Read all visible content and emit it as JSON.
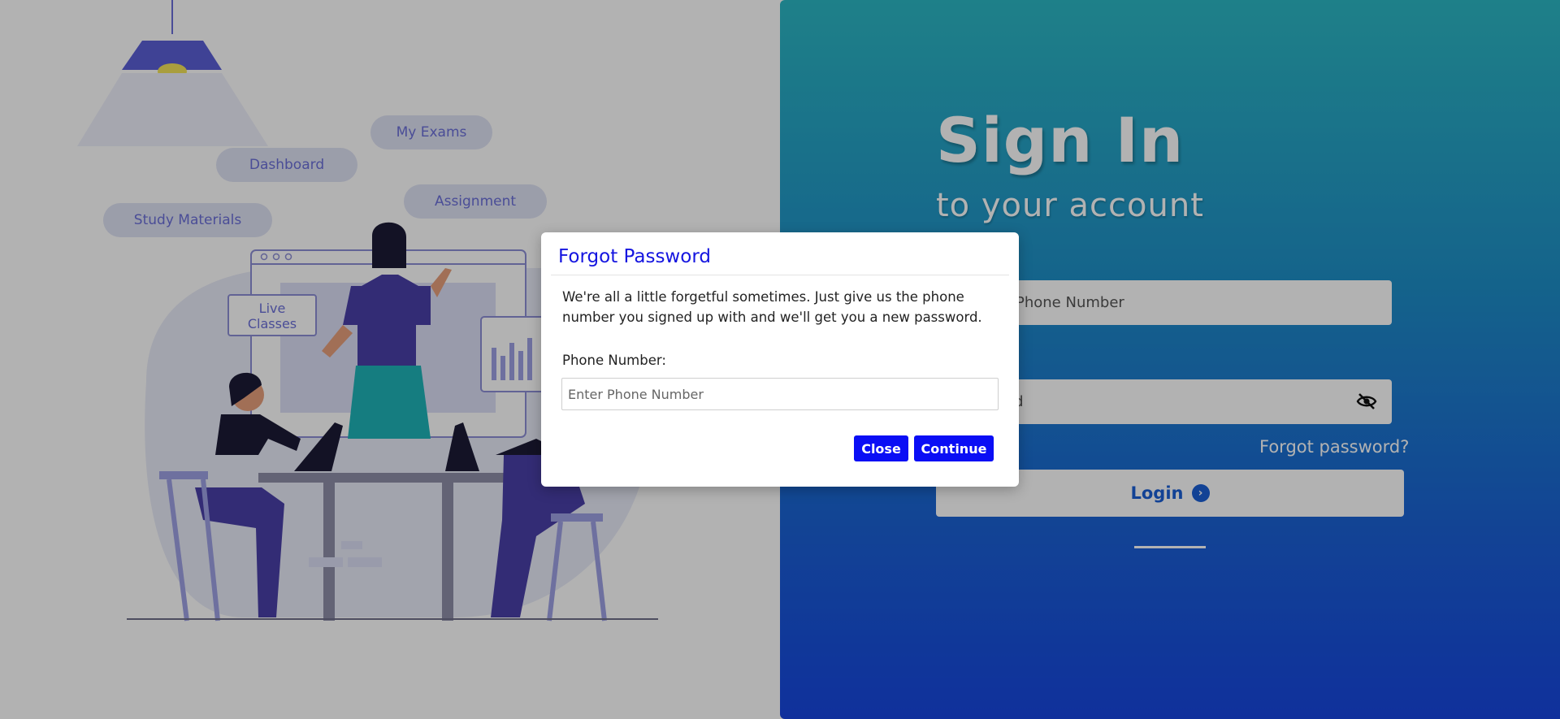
{
  "illustration": {
    "pills": [
      "My Exams",
      "Dashboard",
      "Assignment",
      "Study Materials"
    ],
    "live_classes": "Live\nClasses",
    "live_line1": "Live",
    "live_line2": "Classes"
  },
  "signin": {
    "title": "Sign In",
    "subtitle": "to your account",
    "phone_placeholder": "Phone Number",
    "password_placeholder": "ord",
    "forgot_link": "Forgot password?",
    "login_label": "Login"
  },
  "modal": {
    "title": "Forgot Password",
    "description": "We're all a little forgetful sometimes. Just give us the phone number you signed up with and we'll get you a new password.",
    "phone_label": "Phone Number:",
    "phone_placeholder": "Enter Phone Number",
    "close_label": "Close",
    "continue_label": "Continue"
  },
  "colors": {
    "accent": "#0a0ef5",
    "panel_top": "#2cb8c4",
    "panel_bottom": "#1746e0",
    "illustration_purple": "#4a3fa8"
  },
  "icons": [
    "eye-slash-icon",
    "chevron-right-circle-icon",
    "lamp-icon"
  ]
}
